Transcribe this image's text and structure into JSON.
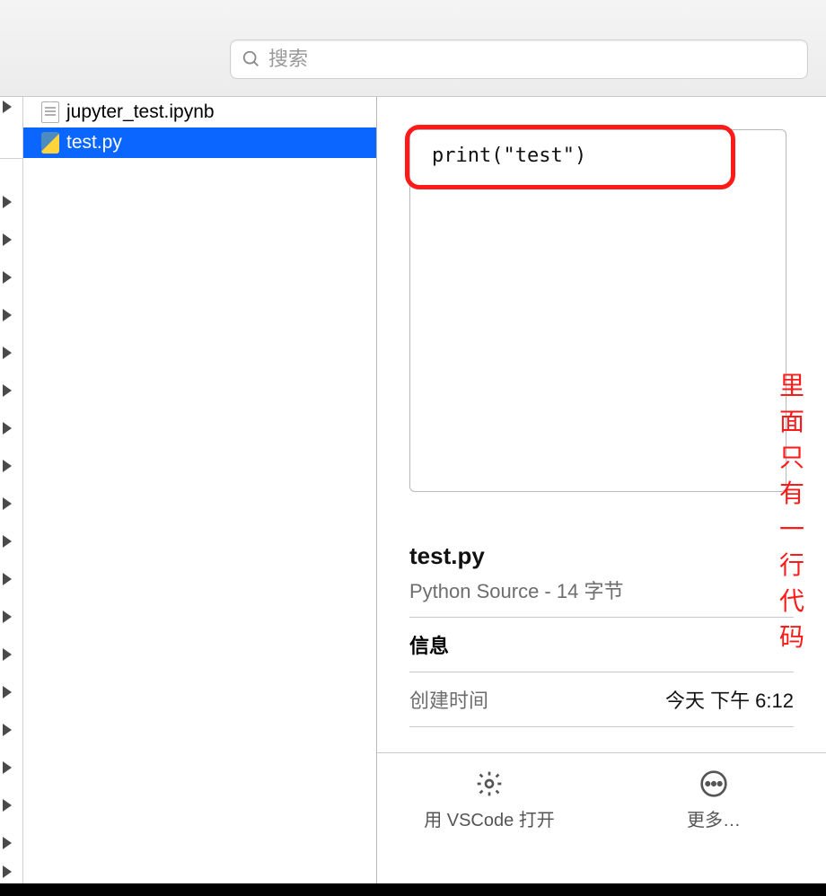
{
  "search": {
    "placeholder": "搜索"
  },
  "files": [
    {
      "name": "jupyter_test.ipynb",
      "icon": "ipynb",
      "selected": false
    },
    {
      "name": "test.py",
      "icon": "py",
      "selected": true
    }
  ],
  "preview": {
    "code_line": "print(\"test\")",
    "annotation": "里面只有一行代码",
    "filename": "test.py",
    "subtitle": "Python Source - 14 字节",
    "info_heading": "信息",
    "created_label": "创建时间",
    "created_value": "今天 下午 6:12"
  },
  "actions": {
    "open_label": "用 VSCode 打开",
    "more_label": "更多…"
  },
  "gutter_triangle_tops": [
    4,
    110,
    152,
    194,
    236,
    278,
    320,
    362,
    404,
    446,
    488,
    530,
    572,
    614,
    656,
    698,
    740,
    782,
    824,
    856
  ]
}
